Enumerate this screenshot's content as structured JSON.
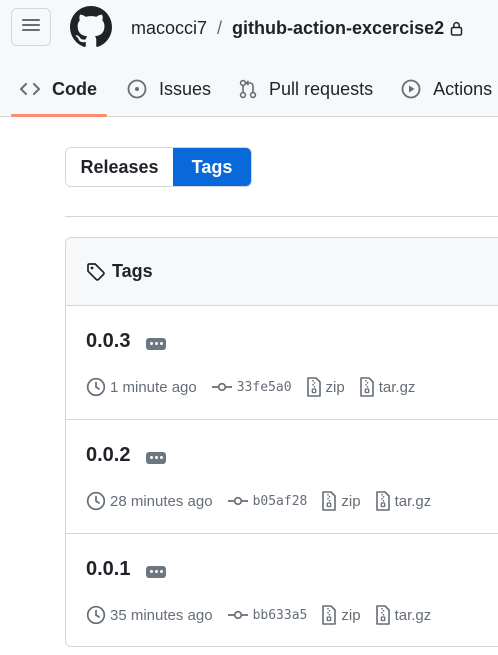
{
  "header": {
    "owner": "macocci7",
    "separator": "/",
    "repo": "github-action-excercise2"
  },
  "tabs": [
    {
      "label": "Code",
      "icon": "code-icon",
      "active": true
    },
    {
      "label": "Issues",
      "icon": "issue-opened-icon",
      "active": false
    },
    {
      "label": "Pull requests",
      "icon": "git-pull-request-icon",
      "active": false
    },
    {
      "label": "Actions",
      "icon": "play-icon",
      "active": false
    }
  ],
  "toggle": {
    "releases_label": "Releases",
    "tags_label": "Tags"
  },
  "tags_box": {
    "title": "Tags",
    "items": [
      {
        "name": "0.0.3",
        "time": "1 minute ago",
        "sha": "33fe5a0",
        "zip": "zip",
        "targz": "tar.gz"
      },
      {
        "name": "0.0.2",
        "time": "28 minutes ago",
        "sha": "b05af28",
        "zip": "zip",
        "targz": "tar.gz"
      },
      {
        "name": "0.0.1",
        "time": "35 minutes ago",
        "sha": "bb633a5",
        "zip": "zip",
        "targz": "tar.gz"
      }
    ]
  },
  "colors": {
    "accent": "#0969da",
    "tab_underline": "#fd8c73",
    "muted": "#656d76",
    "border": "#d0d7de"
  }
}
